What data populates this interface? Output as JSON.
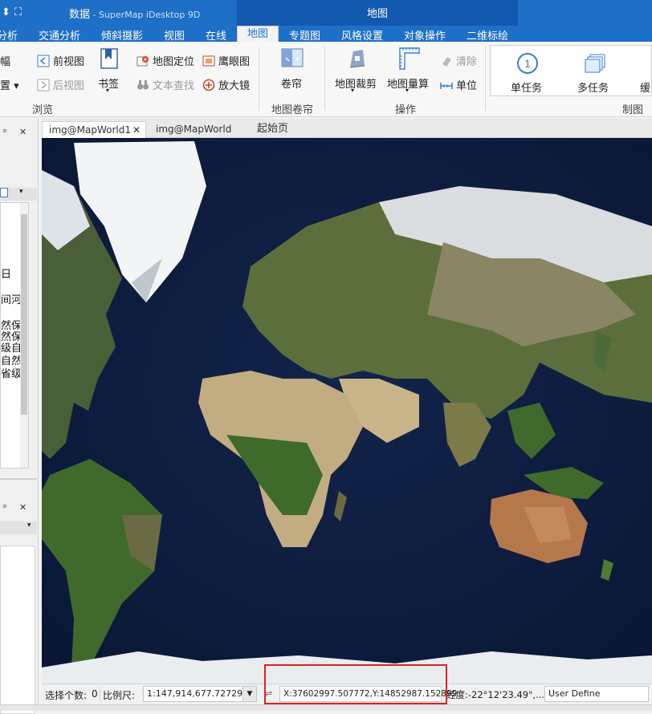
{
  "titlebar": {
    "app_title": "数据",
    "app_sub": " - SuperMap iDesktop 9D",
    "context_group": "地图"
  },
  "ribbon_tabs": [
    "分析",
    "交通分析",
    "倾斜摄影",
    "视图",
    "在线",
    "地图",
    "专题图",
    "风格设置",
    "对象操作",
    "二维标绘"
  ],
  "active_tab": "地图",
  "ribbon": {
    "browse": {
      "partial_top": "幅",
      "partial_bottom": "置",
      "prev_view": "前视图",
      "next_view": "后视图",
      "bookmark": "书签",
      "locate": "地图定位",
      "text_find": "文本查找",
      "eagle_eye": "鹰眼图",
      "magnifier": "放大镜",
      "label": "浏览"
    },
    "swipe": {
      "button": "卷帘",
      "label": "地图卷帘"
    },
    "operate": {
      "clip": "地图裁剪",
      "measure": "地图量算",
      "clear": "清除",
      "unit": "单位",
      "label": "操作"
    },
    "make": {
      "single_task": "单任务",
      "multi_task": "多任务",
      "partial": "缓",
      "label": "制图"
    }
  },
  "doc_tabs": [
    {
      "label": "img@MapWorld1",
      "active": true
    },
    {
      "label": "img@MapWorld",
      "active": false
    },
    {
      "label": "起始页",
      "active": false
    }
  ],
  "left_panel": {
    "pin": "ᵖ",
    "close": "✕",
    "partial_text": [
      "日",
      "间河",
      "然保",
      "然保",
      "级自",
      "自然",
      "省级"
    ]
  },
  "statusbar": {
    "selected_label": "选择个数:",
    "selected_count": "0",
    "scale_label": "比例尺:",
    "scale_value": "1:147,914,677.727296",
    "coords": "X:37602997.507772,Y:14852987.152899",
    "lonlat": "经度:-22°12'23.49\",...",
    "projection": "User Define"
  },
  "colors": {
    "title_blue": "#1e6fc7",
    "context_blue": "#1359b0",
    "highlight_red": "#e02020"
  }
}
